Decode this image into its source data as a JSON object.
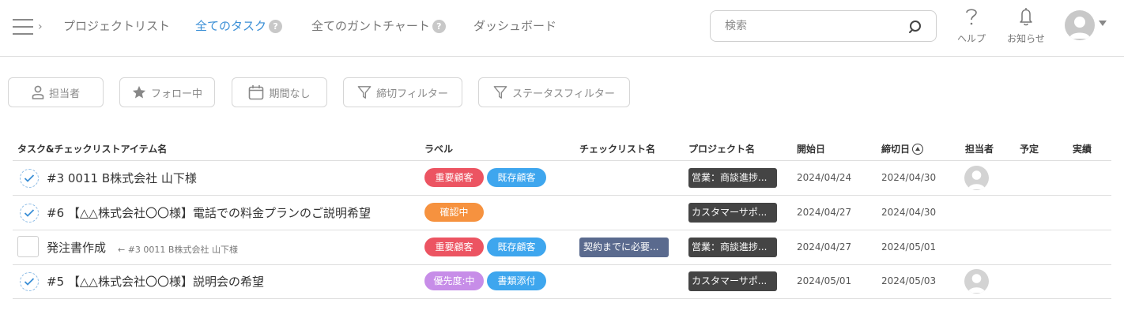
{
  "nav": {
    "items": [
      {
        "label": "プロジェクトリスト",
        "active": false,
        "help": false
      },
      {
        "label": "全てのタスク",
        "active": true,
        "help": true
      },
      {
        "label": "全てのガントチャート",
        "active": false,
        "help": true
      },
      {
        "label": "ダッシュボード",
        "active": false,
        "help": false
      }
    ],
    "help_mark": "?",
    "menu_chevron": "›"
  },
  "search": {
    "placeholder": "検索"
  },
  "header_buttons": {
    "help_label": "ヘルプ",
    "notifications_label": "お知らせ"
  },
  "filters": {
    "assignee": "担当者",
    "following": "フォロー中",
    "no_period": "期間なし",
    "deadline_filter": "締切フィルター",
    "status_filter": "ステータスフィルター"
  },
  "table": {
    "columns": {
      "task": "タスク&チェックリストアイテム名",
      "label": "ラベル",
      "checklist": "チェックリスト名",
      "project": "プロジェクト名",
      "start": "開始日",
      "deadline": "締切日",
      "assignee": "担当者",
      "planned": "予定",
      "actual": "実績"
    },
    "rows": [
      {
        "type": "task",
        "name": "#3 0011 B株式会社 山下様",
        "labels": [
          {
            "text": "重要顧客",
            "color": "#ec5462"
          },
          {
            "text": "既存顧客",
            "color": "#3ea6ee"
          }
        ],
        "checklist": "",
        "project": "営業：商談進捗...",
        "start": "2024/04/24",
        "deadline": "2024/04/30",
        "has_assignee": true
      },
      {
        "type": "task",
        "name": "#6 【△△株式会社〇〇様】電話での料金プランのご説明希望",
        "labels": [
          {
            "text": "確認中",
            "color": "#f6923f"
          }
        ],
        "checklist": "",
        "project": "カスタマーサポ...",
        "start": "2024/04/27",
        "deadline": "2024/04/30",
        "has_assignee": false
      },
      {
        "type": "checklist-item",
        "name": "発注書作成",
        "parent": "← #3 0011 B株式会社 山下様",
        "labels": [
          {
            "text": "重要顧客",
            "color": "#ec5462"
          },
          {
            "text": "既存顧客",
            "color": "#3ea6ee"
          }
        ],
        "checklist": "契約までに必要...",
        "project": "営業：商談進捗...",
        "start": "2024/04/27",
        "deadline": "2024/05/01",
        "has_assignee": false
      },
      {
        "type": "task",
        "name": "#5 【△△株式会社〇〇様】説明会の希望",
        "labels": [
          {
            "text": "優先度:中",
            "color": "#c78de8"
          },
          {
            "text": "書類添付",
            "color": "#3ea6ee"
          }
        ],
        "checklist": "",
        "project": "カスタマーサポ...",
        "start": "2024/05/01",
        "deadline": "2024/05/03",
        "has_assignee": true
      }
    ]
  }
}
